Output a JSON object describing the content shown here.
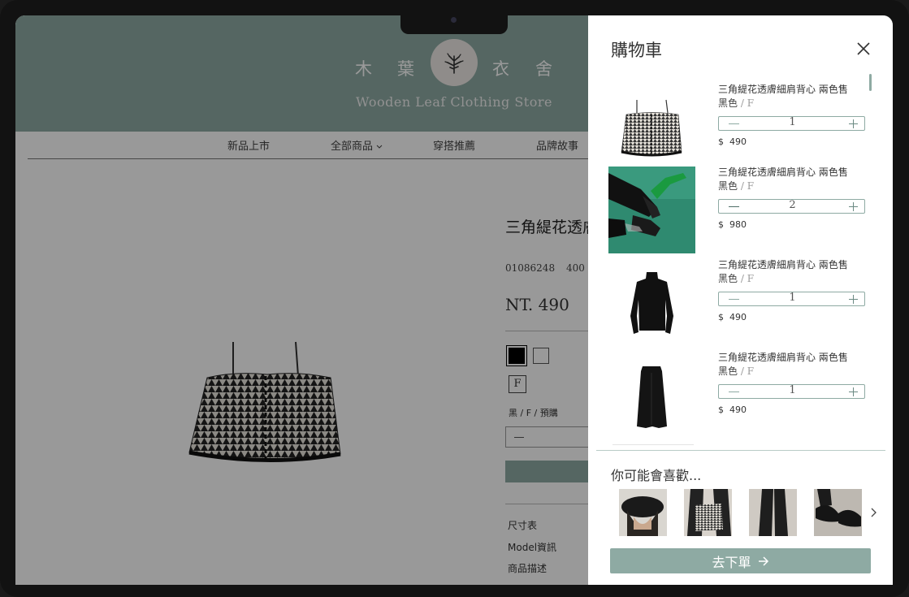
{
  "store": {
    "brand_chars": [
      "木",
      "葉",
      "衣",
      "舍"
    ],
    "tagline": "Wooden Leaf Clothing Store",
    "nav": [
      "新品上市",
      "全部商品",
      "穿搭推薦",
      "品牌故事"
    ]
  },
  "product": {
    "title": "三角緹花透膚細肩背心 兩色售",
    "sku": "01086248",
    "sku_extra": "400",
    "price": "NT. 490",
    "size": "F",
    "variant": "黑 / F / 預購",
    "links": [
      "尺寸表",
      "Model資訊",
      "商品描述"
    ]
  },
  "cart": {
    "title": "購物車",
    "items": [
      {
        "name": "三角緹花透膚細肩背心  兩色售",
        "color": "黑色",
        "size": "F",
        "qty": "1",
        "currency": "$",
        "price": "490",
        "thumb_icon": "camisole-photo"
      },
      {
        "name": "三角緹花透膚細肩背心  兩色售",
        "color": "黑色",
        "size": "F",
        "qty": "2",
        "currency": "$",
        "price": "980",
        "thumb_icon": "lifestyle-legs-photo"
      },
      {
        "name": "三角緹花透膚細肩背心  兩色售",
        "color": "黑色",
        "size": "F",
        "qty": "1",
        "currency": "$",
        "price": "490",
        "thumb_icon": "turtleneck-photo"
      },
      {
        "name": "三角緹花透膚細肩背心  兩色售",
        "color": "黑色",
        "size": "F",
        "qty": "1",
        "currency": "$",
        "price": "490",
        "thumb_icon": "skirt-photo"
      }
    ],
    "recommend_title": "你可能會喜歡...",
    "recommendations": [
      "beret-photo",
      "camisole-outfit-photo",
      "wide-pants-photo",
      "sandals-photo"
    ],
    "checkout_label": "去下單"
  },
  "colors": {
    "accent": "#8eaaa3",
    "overlay": "rgba(0,0,0,0.40)"
  }
}
